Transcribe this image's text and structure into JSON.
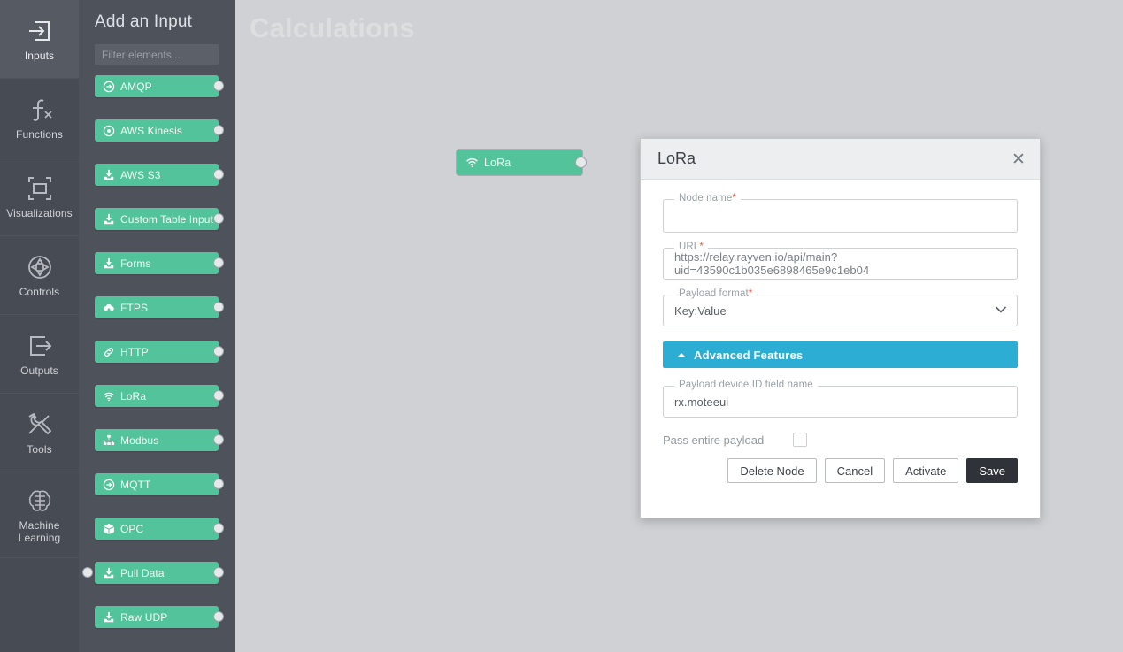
{
  "rail": {
    "items": [
      {
        "label": "Inputs",
        "icon": "inputs-icon",
        "active": true
      },
      {
        "label": "Functions",
        "icon": "functions-icon",
        "active": false
      },
      {
        "label": "Visualizations",
        "icon": "visualizations-icon",
        "active": false
      },
      {
        "label": "Controls",
        "icon": "controls-icon",
        "active": false
      },
      {
        "label": "Outputs",
        "icon": "outputs-icon",
        "active": false
      },
      {
        "label": "Tools",
        "icon": "tools-icon",
        "active": false
      },
      {
        "label": "Machine Learning",
        "icon": "machine-learning-icon",
        "active": false
      }
    ]
  },
  "panel": {
    "title": "Add an Input",
    "filter_placeholder": "Filter elements...",
    "filter_value": "",
    "items": [
      {
        "label": "AMQP",
        "icon": "arrow-circle-right-icon",
        "has_input_port": false
      },
      {
        "label": "AWS Kinesis",
        "icon": "dot-circle-icon",
        "has_input_port": false
      },
      {
        "label": "AWS S3",
        "icon": "download-inbox-icon",
        "has_input_port": false
      },
      {
        "label": "Custom Table Input",
        "icon": "download-inbox-icon",
        "has_input_port": false
      },
      {
        "label": "Forms",
        "icon": "download-inbox-icon",
        "has_input_port": false
      },
      {
        "label": "FTPS",
        "icon": "cloud-download-icon",
        "has_input_port": false
      },
      {
        "label": "HTTP",
        "icon": "link-icon",
        "has_input_port": false
      },
      {
        "label": "LoRa",
        "icon": "wifi-icon",
        "has_input_port": false
      },
      {
        "label": "Modbus",
        "icon": "sitemap-icon",
        "has_input_port": false
      },
      {
        "label": "MQTT",
        "icon": "arrow-circle-right-icon",
        "has_input_port": false
      },
      {
        "label": "OPC",
        "icon": "box-icon",
        "has_input_port": false
      },
      {
        "label": "Pull Data",
        "icon": "download-inbox-icon",
        "has_input_port": true
      },
      {
        "label": "Raw UDP",
        "icon": "download-inbox-icon",
        "has_input_port": false
      }
    ]
  },
  "canvas": {
    "title": "Calculations",
    "node": {
      "label": "LoRa",
      "icon": "wifi-icon"
    }
  },
  "modal": {
    "title": "LoRa",
    "close_icon": "close-icon",
    "fields": {
      "node_name": {
        "legend": "Node name",
        "required_mark": "*",
        "value": ""
      },
      "url": {
        "legend": "URL",
        "required_mark": "*",
        "value": "https://relay.rayven.io/api/main?uid=43590c1b035e6898465e9c1eb04"
      },
      "payload_format": {
        "legend": "Payload format",
        "required_mark": "*",
        "value": "Key:Value",
        "caret_icon": "chevron-down-icon"
      },
      "payload_device_id": {
        "legend": "Payload device ID field name",
        "required_mark": "",
        "value": "rx.moteeui"
      }
    },
    "advanced": {
      "label": "Advanced Features",
      "caret_icon": "caret-up-icon",
      "expanded": true
    },
    "pass_entire_payload": {
      "label": "Pass entire payload",
      "checked": false
    },
    "buttons": [
      {
        "label": "Delete Node",
        "style": "light"
      },
      {
        "label": "Cancel",
        "style": "light"
      },
      {
        "label": "Activate",
        "style": "light"
      },
      {
        "label": "Save",
        "style": "dark"
      }
    ]
  },
  "colors": {
    "rail_bg": "#474b54",
    "panel_bg": "#4d525b",
    "canvas_bg": "#cfd1d4",
    "chip_green": "#52c39a",
    "advanced_cyan": "#2badd4",
    "save_dark": "#2f3339",
    "required_red": "#e35b4b"
  }
}
